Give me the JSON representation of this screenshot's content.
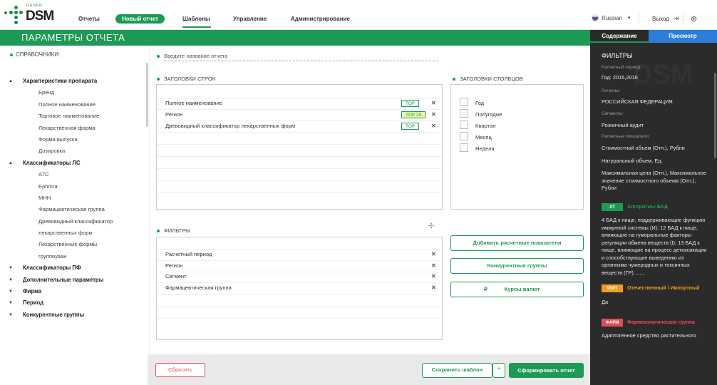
{
  "logo": {
    "top": "GENER",
    "word": "DSM"
  },
  "nav": {
    "reports": "Отчеты",
    "new_report": "Новый отчет",
    "templates": "Шаблоны",
    "management": "Управление",
    "admin": "Администрирование"
  },
  "lang": {
    "label": "Russian",
    "arrow": "▾"
  },
  "logout": "Выход",
  "page_title": "ПАРАМЕТРЫ ОТЧЕТА",
  "sidebar": {
    "title": "СПРАВОЧНИКИ:",
    "groups": [
      {
        "label": "Характеристики препарата",
        "expanded": true,
        "items": [
          "Бренд",
          "Полное наименование",
          "Торговое наименование",
          "Лекарственная форма",
          "Форма выпуска",
          "Дозировка"
        ]
      },
      {
        "label": "Классификаторы ЛС",
        "expanded": true,
        "items": [
          "АТС",
          "Ephmra",
          "МНН",
          "Фармацевтическая группа",
          "Древовидный классификатор",
          "лекарственных форм",
          "Лекарственные формы",
          "группоуаан"
        ]
      },
      {
        "label": "Классификаторы ПФ",
        "expanded": false,
        "items": []
      },
      {
        "label": "Дополнительные параметры",
        "expanded": false,
        "items": []
      },
      {
        "label": "Фирма",
        "expanded": false,
        "items": []
      },
      {
        "label": "Период",
        "expanded": false,
        "items": []
      },
      {
        "label": "Конкурентные группы",
        "expanded": false,
        "items": []
      }
    ]
  },
  "report_name_placeholder": "Введите название отчета",
  "row_headers": {
    "title": "ЗАГОЛОВКИ СТРОК",
    "rows": [
      {
        "label": "Полное наименование",
        "tag": "TOP",
        "highlight": false
      },
      {
        "label": "Регион",
        "tag": "TOP 25",
        "highlight": true
      },
      {
        "label": "Древовидный классификатор лекарственных форм",
        "tag": "TOP",
        "highlight": false
      }
    ]
  },
  "col_headers": {
    "title": "ЗАГОЛОВКИ СТОЛБЦОВ",
    "items": [
      "Год",
      "Полугодие",
      "Квартал",
      "Месяц",
      "Неделя"
    ]
  },
  "filters": {
    "title": "ФИЛЬТРЫ",
    "rows": [
      "Расчетный период",
      "Регион",
      "Сегмент",
      "Фармацевтическая группа"
    ]
  },
  "buttons": {
    "add_indicators": "Добавить расчетные показатели",
    "competitor_groups": "Конкурентные группы",
    "currency_rates": "Курсы валют",
    "reset": "Сбросить",
    "save_template": "Сохранить шаблон",
    "generate": "Сформировать отчет"
  },
  "right": {
    "tab_content": "Содержание",
    "tab_preview": "Просмотр",
    "filters_title": "ФИЛЬТРЫ",
    "period_label": "Расчетный период:",
    "period_value": "Год: 2015,2016",
    "region_label": "Регионы:",
    "region_value": "РОССИЙСКАЯ ФЕДЕРАЦИЯ",
    "segment_label": "Сегменты:",
    "segment_value": "Розничный аудит",
    "indicators_label": "Расчетные показатели:",
    "ind1": "Стоимостной объем (Отп.), Рубли",
    "ind2": "Натуральный объем, Ед.",
    "ind3": "Максимальная цена (Отп.), Максимальное значение стоимостного объема (Отп.), Рубли",
    "b1_badge": "АТ",
    "b1_title": "Алгоритмы БАД",
    "b1_text": "4 БАД к пище, поддерживающие функцию иммунной системы (И); 12 БАД к пище, влияющие на гуморальные факторы регуляции обмена веществ (I); 13 БАД к пище, влияющие на процесс детоксикации и способствующие выведению из организма чужеродных и токсичных веществ (ГР) .......",
    "b2_badge": "ИМП",
    "b2_title": "Отечественный / Импортный",
    "b2_text": "Да",
    "b3_badge": "ФАРМ",
    "b3_title": "Фармакологическая группа",
    "b3_text": "Адаптогенное средство растительного",
    "watermark": "DSM"
  },
  "colors": {
    "green": "#1d9a55",
    "blue": "#2d7ed6",
    "orange": "#f39a1f",
    "red": "#e64a5a",
    "dark": "#2b2b2b"
  }
}
